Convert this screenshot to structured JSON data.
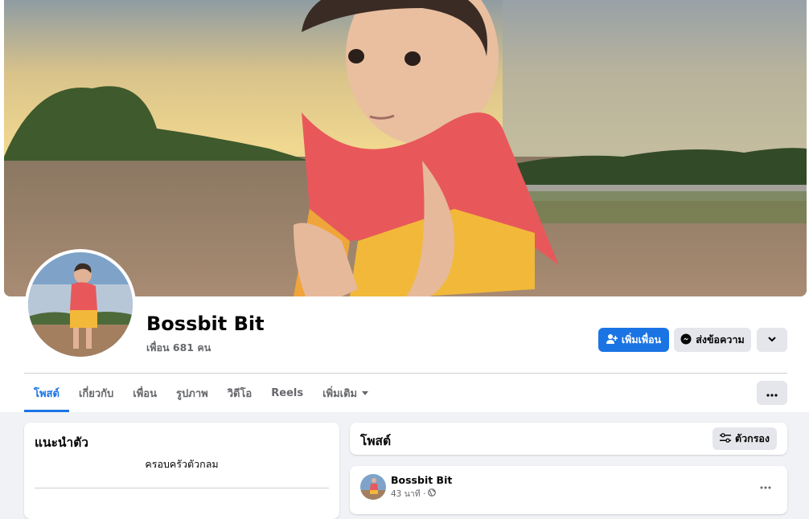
{
  "profile": {
    "name": "Bossbit Bit",
    "friends_text": "เพื่อน 681 คน"
  },
  "actions": {
    "add_friend_label": "เพิ่มเพื่อน",
    "message_label": "ส่งข้อความ"
  },
  "tabs": [
    {
      "label": "โพสต์",
      "active": true
    },
    {
      "label": "เกี่ยวกับ"
    },
    {
      "label": "เพื่อน"
    },
    {
      "label": "รูปภาพ"
    },
    {
      "label": "วิดีโอ"
    },
    {
      "label": "Reels"
    },
    {
      "label": "เพิ่มเติม"
    }
  ],
  "intro": {
    "title": "แนะนำตัว",
    "bio": "ครอบครัวตัวกลม"
  },
  "posts": {
    "title": "โพสต์",
    "filter_label": "ตัวกรอง",
    "first_post": {
      "author": "Bossbit Bit",
      "time": "43 นาที ·",
      "privacy_icon": "globe-icon"
    }
  },
  "colors": {
    "accent": "#1b74e4",
    "background": "#f0f2f5",
    "secondary_text": "#65676b"
  }
}
